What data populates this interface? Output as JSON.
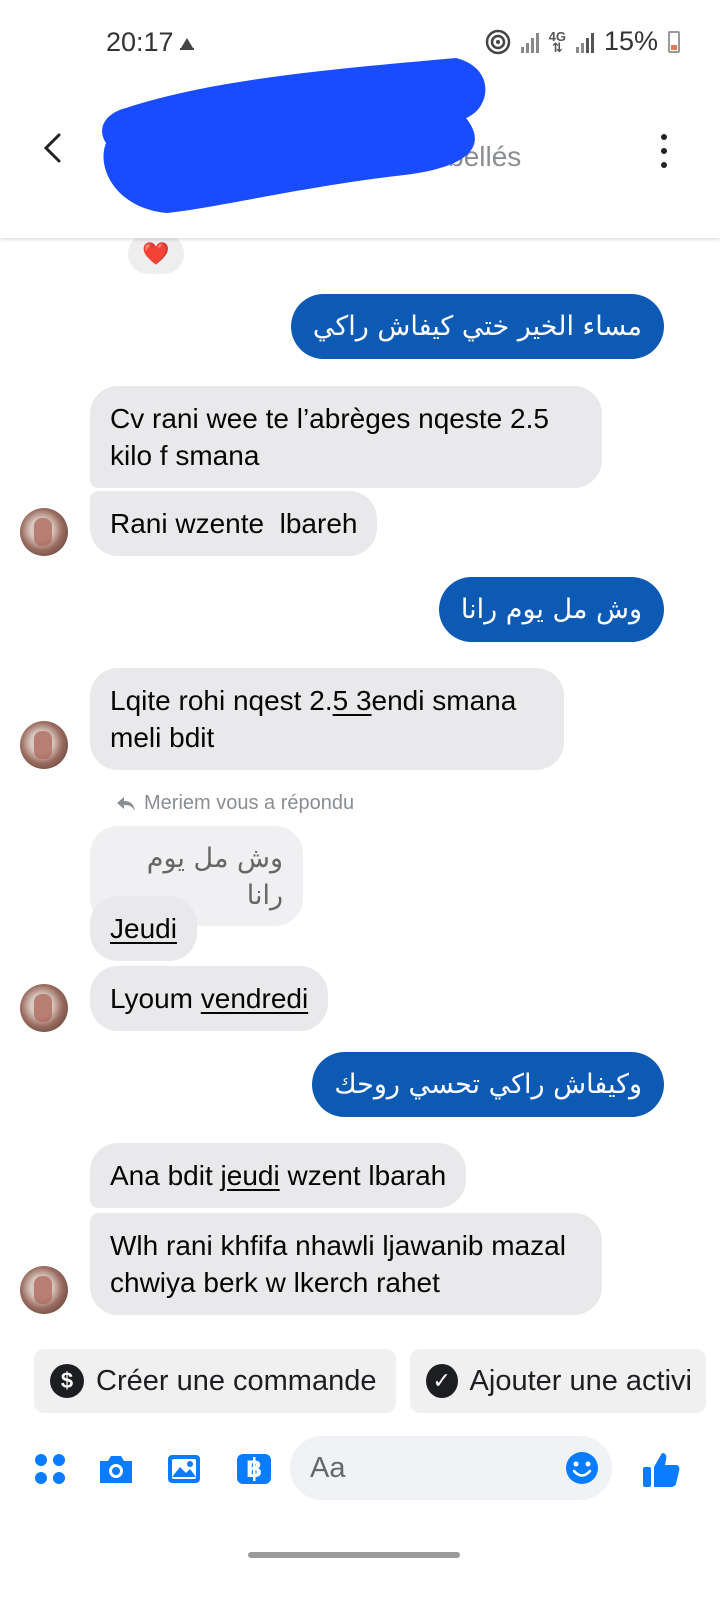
{
  "status_bar": {
    "time": "20:17",
    "network": "4G",
    "battery": "15%"
  },
  "header": {
    "title": "",
    "subtitle": "des détails et des libellés"
  },
  "reaction": "❤️",
  "messages": [
    {
      "dir": "out",
      "text": "مساء الخير ختي كيفاش راكي"
    },
    {
      "dir": "in",
      "text": "Cv rani wee te l’abrèges nqeste 2.5 kilo f smana"
    },
    {
      "dir": "in",
      "text": "Rani wzente  lbareh"
    },
    {
      "dir": "out",
      "text": "وش مل يوم رانا"
    },
    {
      "dir": "in",
      "text_before": "Lqite rohi nqest 2.",
      "text_underlined": "5 3",
      "text_after": "endi smana meli bdit"
    },
    {
      "dir": "in",
      "text": "Jeudi",
      "reply_label": "Meriem vous a répondu",
      "quoted": "وش مل يوم رانا"
    },
    {
      "dir": "in",
      "text_before": "Lyoum ",
      "text_underlined": "vendredi"
    },
    {
      "dir": "out",
      "text": "وكيفاش راكي تحسي روحك"
    },
    {
      "dir": "in",
      "text_before": "Ana bdit ",
      "text_underlined": "jeudi",
      "text_after": " wzent lbarah"
    },
    {
      "dir": "in",
      "text": "Wlh rani khfifa nhawli ljawanib mazal chwiya berk w lkerch rahet"
    }
  ],
  "quick_actions": [
    {
      "label": "Créer une commande",
      "icon": "dollar-icon"
    },
    {
      "label": "Ajouter une activi",
      "icon": "check-circle-icon"
    }
  ],
  "composer": {
    "placeholder": "Aa"
  },
  "colors": {
    "outgoing": "#0d5ab5",
    "incoming": "#e9e9eb",
    "accent": "#0a7cff",
    "redaction": "#1a4cff"
  }
}
